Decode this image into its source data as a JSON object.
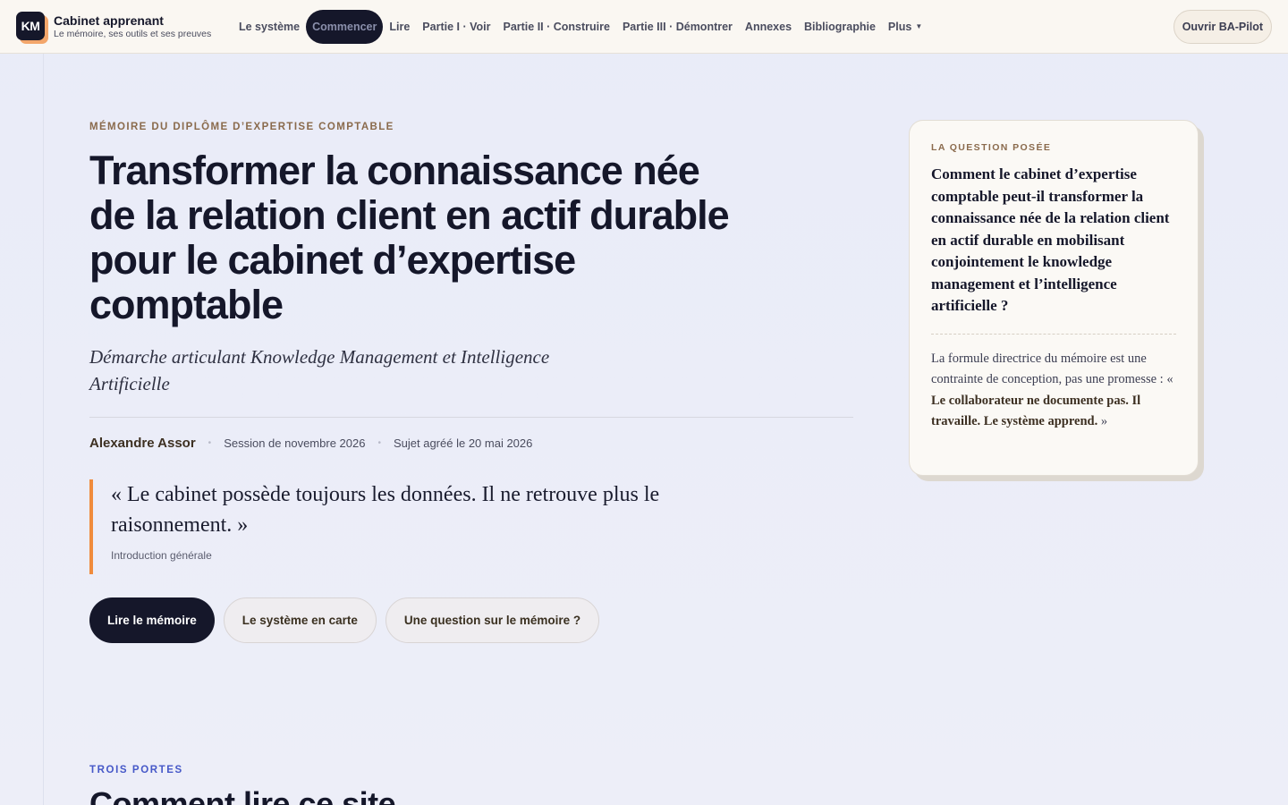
{
  "brand": {
    "logo_text": "KM",
    "name": "Cabinet apprenant",
    "tagline": "Le mémoire, ses outils et ses preuves"
  },
  "nav": {
    "items": [
      {
        "label": "Le système"
      },
      {
        "label": "Commencer",
        "active": true
      },
      {
        "label": "Lire"
      },
      {
        "label": "Partie I · Voir"
      },
      {
        "label": "Partie II · Construire"
      },
      {
        "label": "Partie III · Démontrer"
      },
      {
        "label": "Annexes"
      },
      {
        "label": "Bibliographie"
      },
      {
        "label": "Plus"
      }
    ],
    "pilot_button": "Ouvrir BA-Pilot"
  },
  "hero": {
    "eyebrow": "MÉMOIRE DU DIPLÔME D’EXPERTISE COMPTABLE",
    "title": "Transformer la connaissance née de la relation client en actif durable pour le cabinet d’expertise comptable",
    "subtitle": "Démarche articulant Knowledge Management et Intelligence Artificielle",
    "author": "Alexandre Assor",
    "session": "Session de novembre 2026",
    "approved": "Sujet agréé le 20 mai 2026",
    "quote": "« Le cabinet possède toujours les données. Il ne retrouve plus le raisonnement. »",
    "quote_source": "Introduction générale",
    "cta_primary": "Lire le mémoire",
    "cta_map": "Le système en carte",
    "cta_question": "Une question sur le mémoire ?"
  },
  "card": {
    "eyebrow": "LA QUESTION POSÉE",
    "question": "Comment le cabinet d’expertise comptable peut-il transformer la connaissance née de la relation client en actif durable en mobilisant conjointement le knowledge management et l’intelligence artificielle ?",
    "note_prefix": "La formule directrice du mémoire est une contrainte de conception, pas une promesse : « ",
    "note_bold": "Le collaborateur ne documente pas. Il travaille. Le système apprend.",
    "note_suffix": " »"
  },
  "section": {
    "eyebrow": "TROIS PORTES",
    "title": "Comment lire ce site"
  },
  "colors": {
    "ink": "#15172a",
    "accent_orange": "#f08b3c",
    "eyebrow_brown": "#8a6a4c",
    "section_blue": "#4658c8"
  }
}
